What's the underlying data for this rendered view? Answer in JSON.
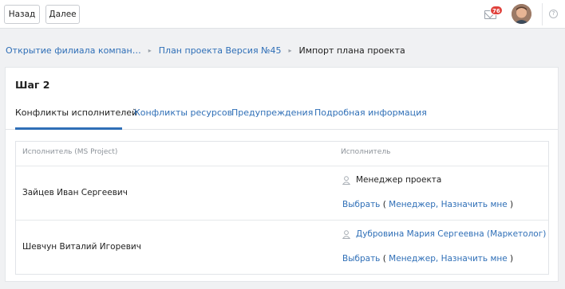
{
  "topbar": {
    "back_label": "Назад",
    "next_label": "Далее",
    "notifications_count": "76",
    "help_label": "?"
  },
  "breadcrumb": {
    "items": [
      "Открытие филиала компан…",
      "План проекта Версия №45",
      "Импорт плана проекта"
    ]
  },
  "page": {
    "step_title": "Шаг 2",
    "tabs": [
      "Конфликты исполнителей",
      "Конфликты ресурсов",
      "Предупреждения",
      "Подробная информация"
    ],
    "active_tab": 0
  },
  "table": {
    "headers": [
      "Исполнитель (MS Project)",
      "Исполнитель"
    ],
    "rows": [
      {
        "ms_project": "Зайцев Иван Сергеевич",
        "assignee": "Менеджер проекта",
        "assignee_is_link": false,
        "choose": "Выбрать",
        "open_paren": "(",
        "manager": "Менеджер",
        "comma": ",",
        "assign_me": "Назначить мне",
        "close_paren": ")"
      },
      {
        "ms_project": "Шевчун Виталий Игоревич",
        "assignee": "Дубровина Мария Сергеевна (Маркетолог)",
        "assignee_is_link": true,
        "choose": "Выбрать",
        "open_paren": "(",
        "manager": "Менеджер",
        "comma": ",",
        "assign_me": "Назначить мне",
        "close_paren": ")"
      }
    ]
  },
  "colors": {
    "link": "#2f6fb7",
    "badge": "#e0413c",
    "background": "#f0f1f3"
  },
  "icons": [
    "mail-icon",
    "avatar",
    "help-icon",
    "chevron-right-icon",
    "person-icon"
  ]
}
